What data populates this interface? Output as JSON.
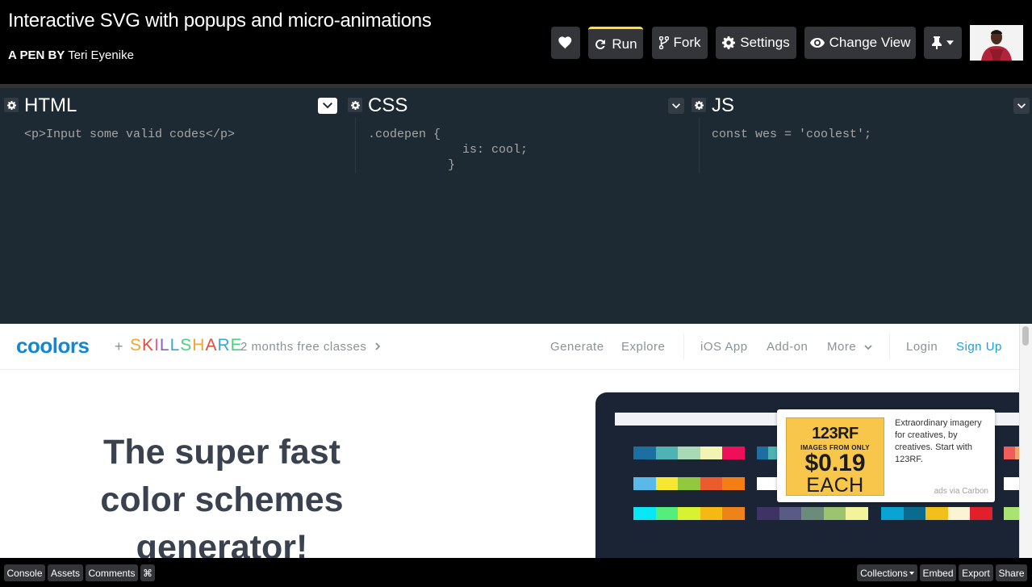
{
  "header": {
    "title": "Interactive SVG with popups and micro-animations",
    "author_prefix": "A PEN BY",
    "author_name": "Teri Eyenike",
    "buttons": {
      "run": "Run",
      "fork": "Fork",
      "settings": "Settings",
      "change_view": "Change View"
    },
    "icons": [
      "heart-icon",
      "refresh-icon",
      "fork-icon",
      "gear-icon",
      "eye-icon",
      "pin-icon",
      "chevron-down-icon"
    ]
  },
  "editors": [
    {
      "title": "HTML",
      "code": "<p>Input some valid codes</p>"
    },
    {
      "title": "CSS",
      "code": ".codepen {\n             is: cool;\n           }"
    },
    {
      "title": "JS",
      "code": "const wes = 'coolest';"
    }
  ],
  "preview": {
    "nav": {
      "logo": "coolors",
      "plus": "+",
      "skillshare": "SKILLSHARE",
      "promo": "2 months free classes",
      "links": {
        "generate": "Generate",
        "explore": "Explore",
        "ios_app": "iOS App",
        "add_on": "Add-on",
        "more": "More",
        "login": "Login",
        "signup": "Sign Up"
      }
    },
    "hero": "The super fast color schemes generator!",
    "ad": {
      "brand": "123RF",
      "from": "IMAGES FROM ONLY",
      "price": "$0.19",
      "each": "EACH",
      "text": "Extraordinary imagery for creatives, by creatives. Start with 123RF.",
      "via": "ads via Carbon"
    },
    "palettes": [
      [
        "#1e6fa1",
        "#4fb3b4",
        "#a7dab5",
        "#f2f4b3",
        "#ee0f58"
      ],
      [
        "#1e6fa1",
        "#4fb3b4"
      ],
      [
        "#f5b07a",
        "#ef5e5a",
        "#cfc7a5",
        "#a9dfb6",
        "#e4eec7"
      ],
      [
        "#ef5e5a",
        "#f0a36c"
      ],
      [
        "#5ab8ea",
        "#f7e733",
        "#92c83e",
        "#ec5b2d",
        "#f57e14"
      ],
      [
        "#ffffff",
        "#7fd8c3",
        "#a4f1ca",
        "#f99f98",
        "#f0606a"
      ],
      [
        "#3a4258",
        "#8d97ab",
        "#e7ecf1",
        "#ef2449",
        "#d3152f"
      ],
      [
        "#ffffff"
      ],
      [
        "#08e8f4",
        "#55ee7d",
        "#d6f230",
        "#f4ba13",
        "#ee8419"
      ],
      [
        "#3d3465",
        "#5a5a87",
        "#6c8c79",
        "#9cc46f",
        "#f3f39b"
      ],
      [
        "#09a4d3",
        "#0a6b8e",
        "#f1c01b",
        "#faf4d4",
        "#e2202b"
      ],
      [
        "#a9e473"
      ]
    ]
  },
  "footer": {
    "console": "Console",
    "assets": "Assets",
    "comments": "Comments",
    "shortcut": "⌘",
    "collections": "Collections",
    "embed": "Embed",
    "export": "Export",
    "share": "Share"
  }
}
